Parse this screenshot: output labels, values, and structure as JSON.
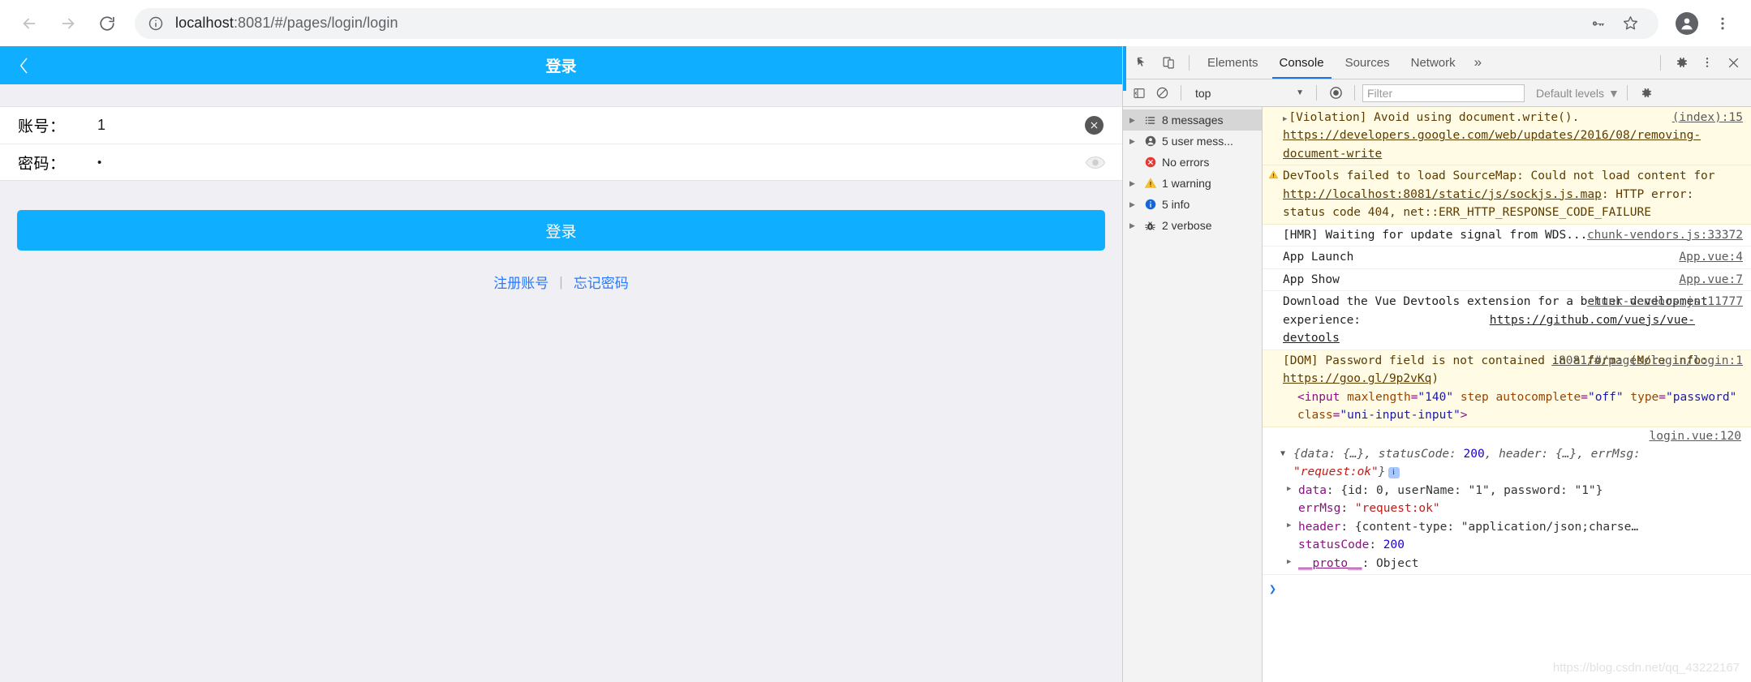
{
  "browser": {
    "back_label": "Back",
    "forward_label": "Forward",
    "reload_label": "Reload",
    "url_host": "localhost",
    "url_rest": ":8081/#/pages/login/login",
    "url_full": "localhost:8081/#/pages/login/login",
    "site_info_label": "View site information",
    "password_manager_label": "Passwords",
    "bookmark_label": "Bookmark this tab",
    "profile_label": "Profile",
    "menu_label": "Customize and control Google Chrome"
  },
  "app": {
    "title": "登录",
    "back_label": "返回",
    "form": [
      {
        "label": "账号：",
        "value": "1",
        "type": "text",
        "action_icon": "clear-circle-icon"
      },
      {
        "label": "密码：",
        "value": "•",
        "type": "password",
        "action_icon": "eye-icon"
      }
    ],
    "login_button": "登录",
    "links": [
      {
        "label": "注册账号"
      },
      {
        "label": "忘记密码"
      }
    ],
    "link_separator": "|",
    "accent_color": "#10aeff",
    "link_color": "#2979ff"
  },
  "devtools": {
    "inspect_label": "Inspect element",
    "device_label": "Toggle device toolbar",
    "tabs": [
      {
        "label": "Elements",
        "active": false
      },
      {
        "label": "Console",
        "active": true
      },
      {
        "label": "Sources",
        "active": false
      },
      {
        "label": "Network",
        "active": false
      }
    ],
    "more_tabs_label": "»",
    "settings_label": "Settings",
    "dots_label": "More options",
    "close_label": "Close DevTools",
    "toolbar": {
      "sidebar_toggle_label": "Hide console sidebar",
      "clear_label": "Clear console",
      "context": "top",
      "context_caret": "▼",
      "eye_label": "Live expressions",
      "filter_placeholder": "Filter",
      "filter_value": "",
      "levels_label": "Default levels",
      "levels_caret": "▼",
      "settings_label": "Console settings"
    },
    "sidebar": [
      {
        "label": "8 messages",
        "icon": "list-icon",
        "arrow": true,
        "selected": true
      },
      {
        "label": "5 user mess...",
        "icon": "user-icon",
        "arrow": true,
        "selected": false
      },
      {
        "label": "No errors",
        "icon": "error-icon",
        "arrow": false,
        "selected": false
      },
      {
        "label": "1 warning",
        "icon": "warning-icon",
        "arrow": true,
        "selected": false
      },
      {
        "label": "5 info",
        "icon": "info-icon",
        "arrow": true,
        "selected": false
      },
      {
        "label": "2 verbose",
        "icon": "bug-icon",
        "arrow": true,
        "selected": false
      }
    ],
    "messages": {
      "violation": {
        "text_1": "[Violation] Avoid using document.write(). ",
        "link": "https://developers.google.com/web/updates/2016/08/removing-document-write",
        "source": "(index):15"
      },
      "sourcemap": {
        "pre": "DevTools failed to load SourceMap: Could not load content for ",
        "link": "http://localhost:8081/static/js/sockjs.js.map",
        "post": ": HTTP error: status code 404, net::ERR_HTTP_RESPONSE_CODE_FAILURE"
      },
      "hmr": {
        "text": "[HMR] Waiting for update signal from WDS...",
        "source": "chunk-vendors.js:33372"
      },
      "app_launch": {
        "text": "App Launch",
        "source": "App.vue:4"
      },
      "app_show": {
        "text": "App Show",
        "source": "App.vue:7"
      },
      "vue_devtools": {
        "pre": "Download the Vue Devtools extension for a better development experience: ",
        "link": "https://github.com/vuejs/vue-devtools",
        "source": "chunk-vendors.js:11777"
      },
      "dom_password": {
        "pre": "[DOM] Password field is not contained in a form: (More info: ",
        "link": "https://goo.gl/9p2vKq",
        "post": ")",
        "source": ":8081/#/pages/login/login:1",
        "code": {
          "tag_open": "<input ",
          "a1_name": "maxlength",
          "a1_val": "\"140\"",
          "a2_name": "step",
          "a3_name": "autocomplete",
          "a3_val": "\"off\"",
          "a4_name": "type",
          "a4_val": "\"password\"",
          "a5_name": "class",
          "a5_val": "\"uni-input-input\"",
          "tag_close": ">"
        }
      },
      "response_object": {
        "source": "login.vue:120",
        "summary_pre": "{data: {…}, statusCode: ",
        "summary_status": "200",
        "summary_mid": ", header: {…}, errMsg: ",
        "summary_err": "\"request:ok\"",
        "summary_post": "}",
        "children": [
          {
            "key": "data",
            "sep": ": ",
            "value": "{id: 0, userName: \"1\", password: \"1\"}",
            "expandable": true
          },
          {
            "key": "errMsg",
            "sep": ": ",
            "value": "\"request:ok\"",
            "expandable": false
          },
          {
            "key": "header",
            "sep": ": ",
            "value": "{content-type: \"application/json;charse…",
            "expandable": true
          },
          {
            "key": "statusCode",
            "sep": ": ",
            "value": "200",
            "expandable": false
          },
          {
            "key": "__proto__",
            "sep": ": ",
            "value": "Object",
            "expandable": true
          }
        ]
      }
    },
    "prompt_caret": "❯",
    "watermark": "https://blog.csdn.net/qq_43222167"
  }
}
